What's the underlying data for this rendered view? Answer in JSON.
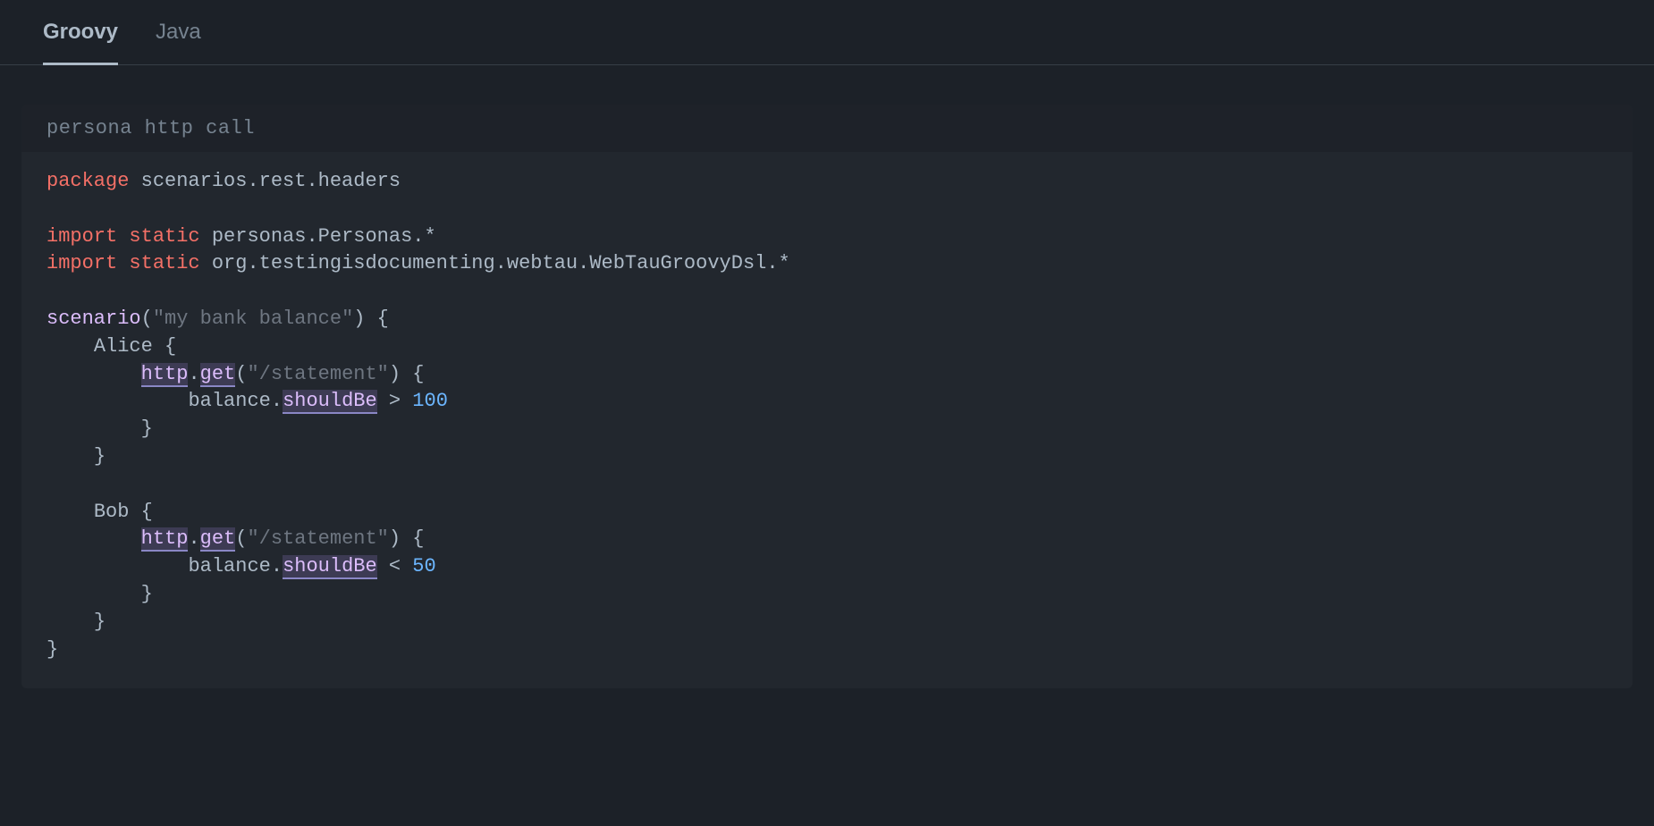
{
  "tabs": [
    {
      "label": "Groovy",
      "active": true
    },
    {
      "label": "Java",
      "active": false
    }
  ],
  "code": {
    "title": "persona http call",
    "lines": {
      "l1_package_kw": "package",
      "l1_package_name": " scenarios.rest.headers",
      "l3_import_kw": "import",
      "l3_static_kw": " static ",
      "l3_pkg": "personas.Personas.*",
      "l4_import_kw": "import",
      "l4_static_kw": " static ",
      "l4_pkg": "org.testingisdocumenting.webtau.WebTauGroovyDsl.*",
      "l6_fn": "scenario",
      "l6_str": "\"my bank balance\"",
      "l7_id": "Alice",
      "l8_http": "http",
      "l8_dot": ".",
      "l8_get": "get",
      "l8_str": "\"/statement\"",
      "l9_balance": "balance.",
      "l9_shouldBe": "shouldBe",
      "l9_op": " > ",
      "l9_num": "100",
      "l13_id": "Bob",
      "l14_http": "http",
      "l14_dot": ".",
      "l14_get": "get",
      "l14_str": "\"/statement\"",
      "l15_balance": "balance.",
      "l15_shouldBe": "shouldBe",
      "l15_op": " < ",
      "l15_num": "50",
      "brace_open": "{",
      "brace_close": "}",
      "paren_open": "(",
      "paren_close": ")"
    }
  }
}
